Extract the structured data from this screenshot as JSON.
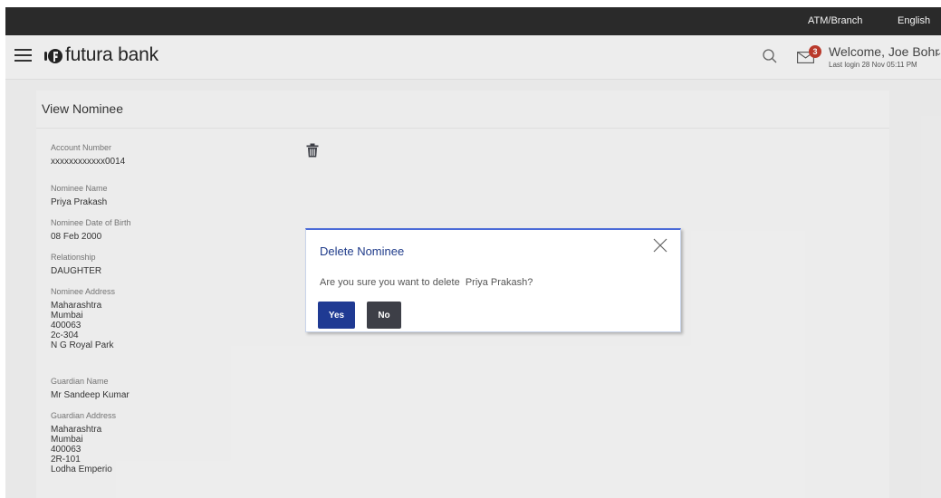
{
  "topbar": {
    "atm_branch": "ATM/Branch",
    "language": "English"
  },
  "header": {
    "bank_name": "futura bank",
    "notification_count": "3",
    "welcome": "Welcome, Joe Bohr",
    "last_login": "Last login 28 Nov 05:11 PM"
  },
  "page": {
    "title": "View Nominee",
    "fields": {
      "account_number": {
        "label": "Account Number",
        "value": "xxxxxxxxxxxx0014"
      },
      "nominee_name": {
        "label": "Nominee Name",
        "value": "Priya Prakash"
      },
      "nominee_dob": {
        "label": "Nominee Date of Birth",
        "value": "08 Feb 2000"
      },
      "relationship": {
        "label": "Relationship",
        "value": "DAUGHTER"
      },
      "nominee_address": {
        "label": "Nominee Address",
        "lines": [
          "Maharashtra",
          "Mumbai",
          "400063",
          "2c-304",
          "N G Royal Park"
        ]
      },
      "guardian_name": {
        "label": "Guardian Name",
        "value": "Mr Sandeep Kumar"
      },
      "guardian_address": {
        "label": "Guardian Address",
        "lines": [
          "Maharashtra",
          "Mumbai",
          "400063",
          "2R-101",
          "Lodha Emperio"
        ]
      }
    }
  },
  "dialog": {
    "title": "Delete Nominee",
    "message": "Are you sure you want to delete  Priya Prakash?",
    "yes_label": "Yes",
    "no_label": "No"
  },
  "colors": {
    "primary": "#1f3a93",
    "secondary": "#3d3f47",
    "topbar": "#2a2a2a",
    "badge": "#c0392b"
  },
  "icons": [
    "hamburger-menu-icon",
    "futura-logo-icon",
    "search-icon",
    "mail-icon",
    "trash-icon",
    "close-icon",
    "chevron-down-icon"
  ]
}
